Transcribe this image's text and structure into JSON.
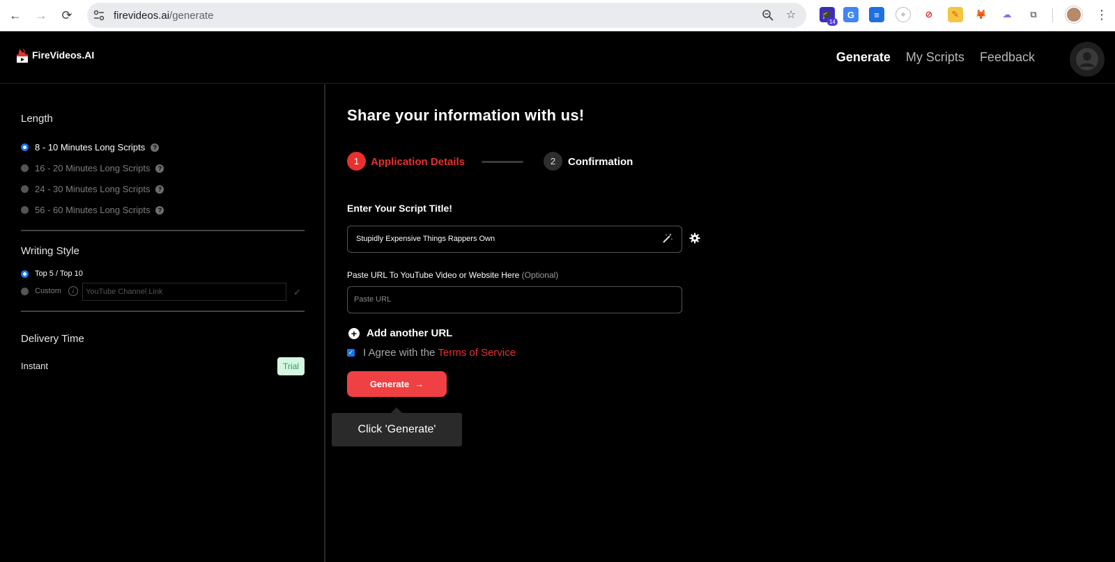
{
  "browser": {
    "url_host": "firevideos.ai",
    "url_path": "/generate",
    "extension_badge": "14",
    "colors": {
      "chrome_bg": "#ffffff",
      "omnibox_bg": "#e9ebee"
    }
  },
  "header": {
    "logo_text": "FireVideos.AI",
    "nav": [
      {
        "label": "Generate",
        "active": true
      },
      {
        "label": "My Scripts",
        "active": false
      },
      {
        "label": "Feedback",
        "active": false
      }
    ]
  },
  "sidebar": {
    "length": {
      "title": "Length",
      "options": [
        {
          "label": "8 - 10 Minutes Long Scripts",
          "selected": true
        },
        {
          "label": "16 - 20 Minutes Long Scripts",
          "selected": false
        },
        {
          "label": "24 - 30 Minutes Long Scripts",
          "selected": false
        },
        {
          "label": "56 - 60 Minutes Long Scripts",
          "selected": false
        }
      ]
    },
    "writing_style": {
      "title": "Writing Style",
      "options": [
        {
          "label": "Top 5 / Top 10",
          "selected": true
        },
        {
          "label": "Custom",
          "selected": false
        }
      ],
      "channel_placeholder": "YouTube Channel Link"
    },
    "delivery": {
      "title": "Delivery Time",
      "value": "Instant",
      "badge": "Trial"
    }
  },
  "main": {
    "title": "Share your information with us!",
    "steps": [
      {
        "number": "1",
        "label": "Application Details",
        "active": true
      },
      {
        "number": "2",
        "label": "Confirmation",
        "active": false
      }
    ],
    "script_title_label": "Enter Your Script Title!",
    "script_title_value": "Stupidly Expensive Things Rappers Own",
    "url_label": "Paste URL To YouTube Video or Website Here",
    "url_label_optional": "(Optional)",
    "url_placeholder": "Paste URL",
    "add_url_label": "Add another URL",
    "agree_text": "I Agree with the",
    "tos_link": "Terms of Service",
    "agree_checked": true,
    "generate_label": "Generate",
    "tooltip": "Click 'Generate'"
  },
  "colors": {
    "accent": "#ef4044",
    "accent_text": "#e8302e",
    "background": "#000000",
    "trial_bg": "#d5f6e3",
    "trial_text": "#2e9a5a"
  }
}
